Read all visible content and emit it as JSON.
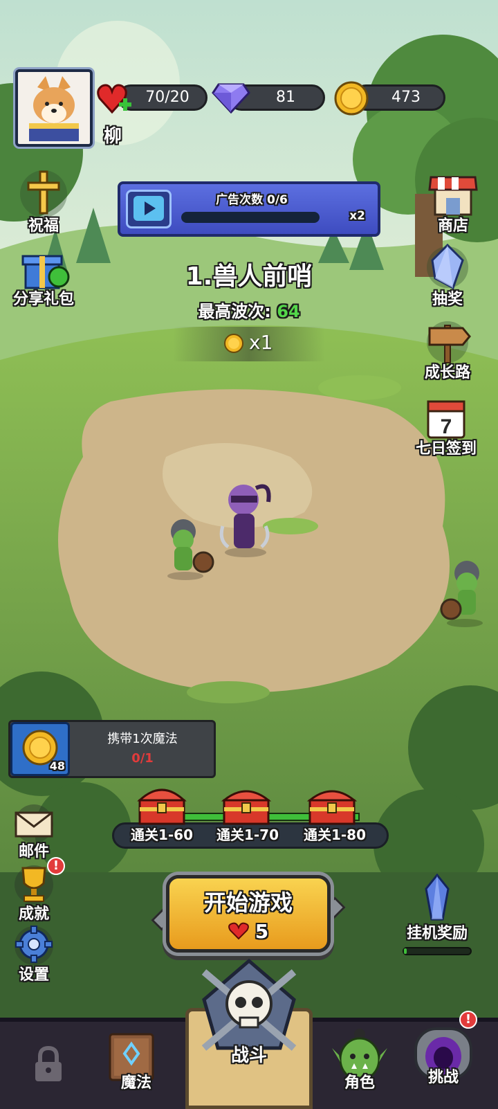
{
  "player": {
    "name": "柳"
  },
  "resources": {
    "stamina": "70/20",
    "gems": "81",
    "coins": "473"
  },
  "ad": {
    "title": "广告次数 0/6",
    "progress": 0,
    "multiplier": "x2"
  },
  "left_menu": [
    {
      "label": "祝福",
      "icon": "cross-icon"
    },
    {
      "label": "分享礼包",
      "icon": "gift-icon"
    }
  ],
  "right_menu": [
    {
      "label": "商店",
      "icon": "shop-icon"
    },
    {
      "label": "抽奖",
      "icon": "crystal-icon"
    },
    {
      "label": "成长路",
      "icon": "signpost-icon"
    },
    {
      "label": "七日签到",
      "icon": "calendar-icon",
      "calendar_day": "7"
    }
  ],
  "level": {
    "title": "1.兽人前哨",
    "best_wave_label": "最高波次:",
    "best_wave_value": "64",
    "coin_multiplier": "x1"
  },
  "magic": {
    "label": "携带1次魔法",
    "count": "0/1",
    "coin_count": "48"
  },
  "chests": [
    {
      "label": "通关1-60"
    },
    {
      "label": "通关1-70"
    },
    {
      "label": "通关1-80"
    }
  ],
  "left_bottom_menu": [
    {
      "label": "邮件",
      "icon": "mail-icon",
      "badge": false
    },
    {
      "label": "成就",
      "icon": "trophy-icon",
      "badge": true
    },
    {
      "label": "设置",
      "icon": "gear-icon",
      "badge": false
    }
  ],
  "start": {
    "label": "开始游戏",
    "cost": "5"
  },
  "idle_reward": {
    "label": "挂机奖励",
    "progress": 0.04
  },
  "bottom_nav": [
    {
      "label": "",
      "icon": "lock-icon"
    },
    {
      "label": "魔法",
      "icon": "spellbook-icon"
    },
    {
      "label": "战斗",
      "icon": "skull-swords-icon",
      "active": true
    },
    {
      "label": "角色",
      "icon": "orc-head-icon"
    },
    {
      "label": "挑战",
      "icon": "portal-icon",
      "badge": true
    }
  ],
  "colors": {
    "wave_value": "#54d64a",
    "magic_count": "#e23b3b",
    "badge": "#e23b3b"
  }
}
